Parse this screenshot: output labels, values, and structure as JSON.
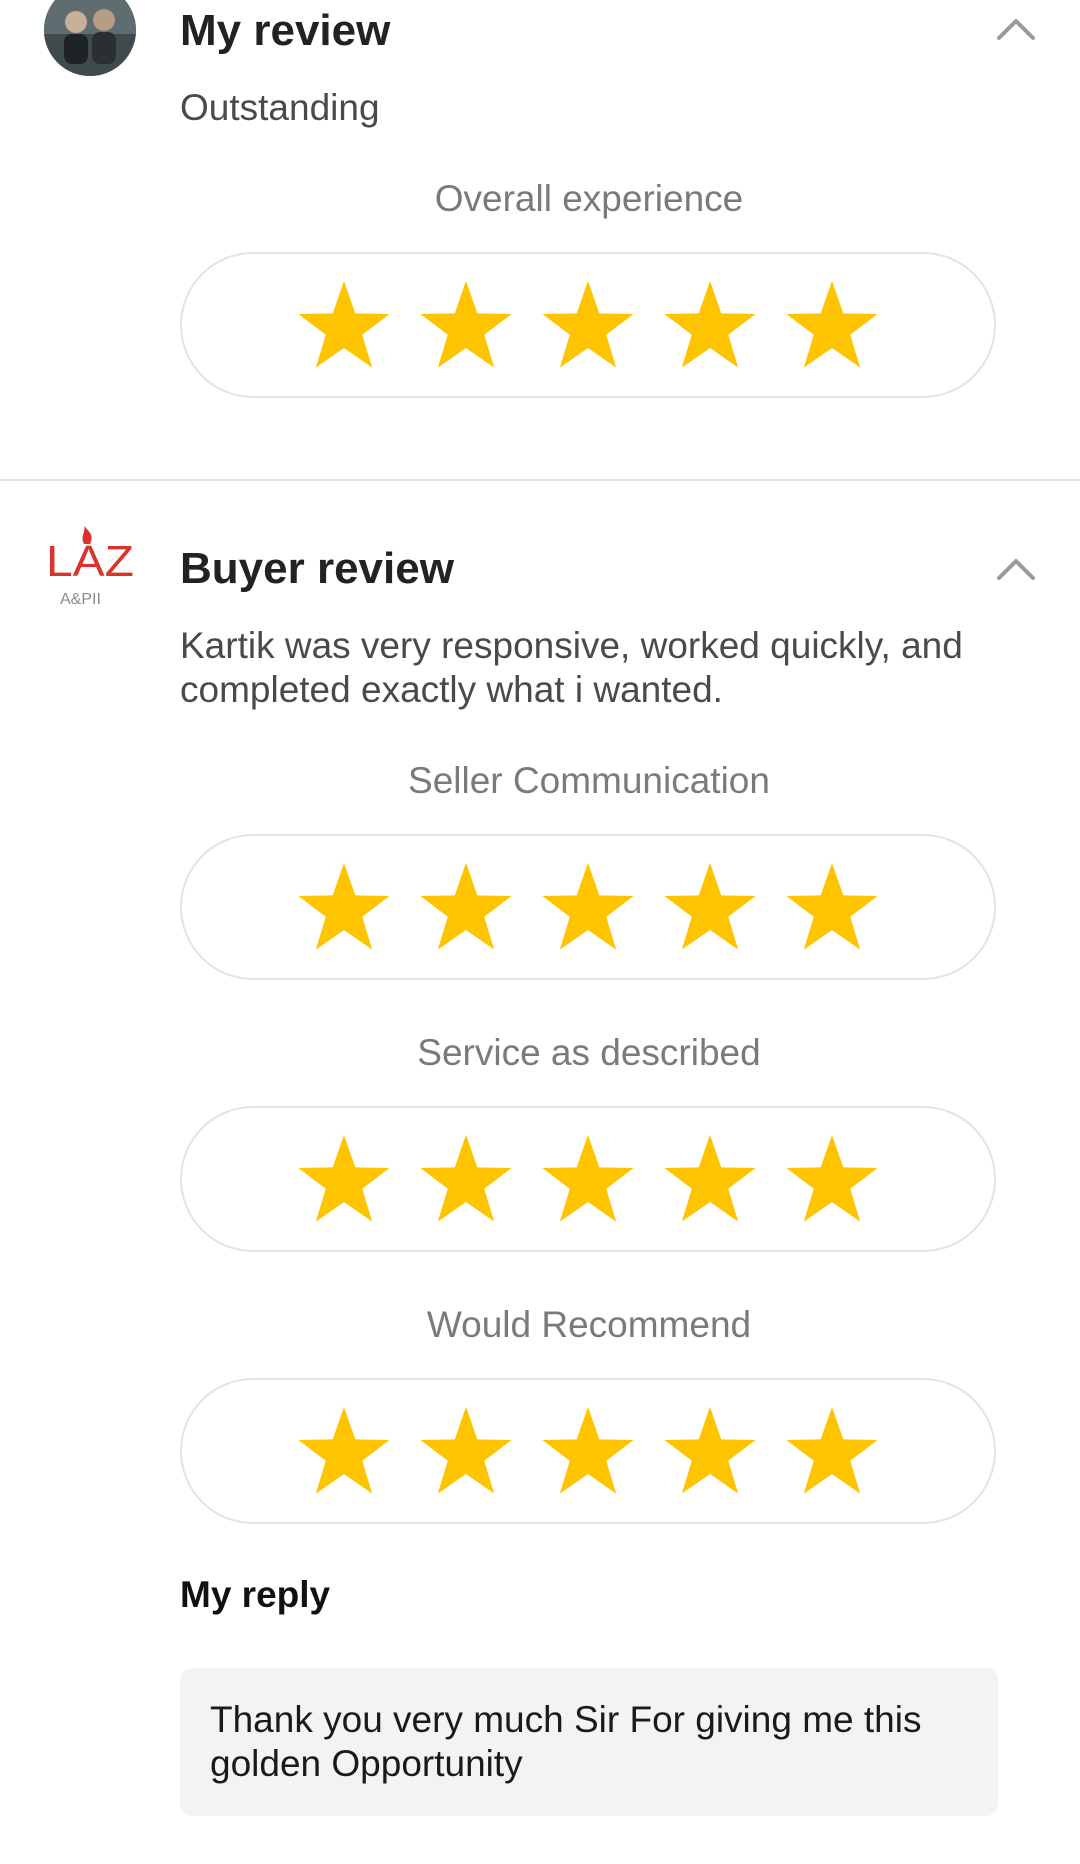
{
  "my_review": {
    "title": "My review",
    "text": "Outstanding",
    "ratings": [
      {
        "label": "Overall experience",
        "stars": 5,
        "max": 5
      }
    ]
  },
  "buyer_review": {
    "logo_text": "LAZ",
    "logo_subtext": "A&PII",
    "title": "Buyer review",
    "text": "Kartik was very responsive, worked quickly, and completed exactly what i wanted.",
    "ratings": [
      {
        "label": "Seller Communication",
        "stars": 5,
        "max": 5
      },
      {
        "label": "Service as described",
        "stars": 5,
        "max": 5
      },
      {
        "label": "Would Recommend",
        "stars": 5,
        "max": 5
      }
    ]
  },
  "my_reply": {
    "title": "My reply",
    "text": "Thank you very much Sir For giving me this golden Opportunity"
  },
  "icons": {
    "collapse": "chevron-up-icon",
    "star": "star-icon"
  },
  "colors": {
    "star": "#FFC400",
    "logo_red": "#D9342B",
    "pill_border": "#e3e3e3",
    "reply_bg": "#f3f3f3"
  }
}
